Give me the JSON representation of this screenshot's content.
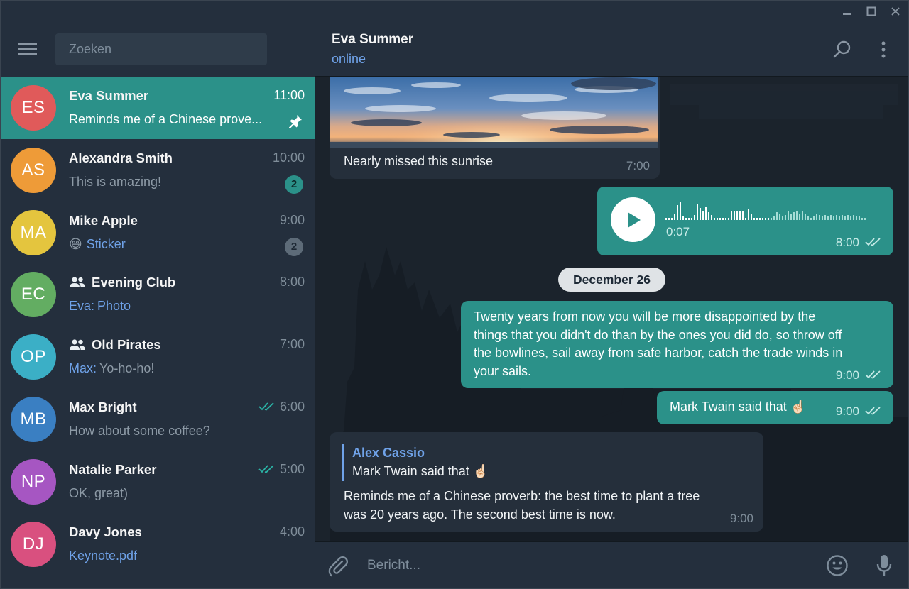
{
  "search": {
    "placeholder": "Zoeken"
  },
  "chats": [
    {
      "initials": "ES",
      "name": "Eva Summer",
      "time": "11:00",
      "preview": "Reminds me of a Chinese prove...",
      "avatar_color": "#e05a5a",
      "active": true,
      "pinned": true
    },
    {
      "initials": "AS",
      "name": "Alexandra Smith",
      "time": "10:00",
      "preview": "This is amazing!",
      "avatar_color": "#ee9b38",
      "badge": "2",
      "badge_style": "teal"
    },
    {
      "initials": "MA",
      "name": "Mike Apple",
      "time": "9:00",
      "preview": "Sticker",
      "preview_emoji": "😄",
      "avatar_color": "#e4c53e",
      "badge": "2",
      "badge_style": "grey"
    },
    {
      "initials": "EC",
      "name": "Evening Club",
      "time": "8:00",
      "preview_sender": "Eva:",
      "preview": "Photo",
      "avatar_color": "#63ad62",
      "group": true
    },
    {
      "initials": "OP",
      "name": "Old Pirates",
      "time": "7:00",
      "preview_sender": "Max:",
      "preview": "Yo-ho-ho!",
      "avatar_color": "#3bafc6",
      "group": true
    },
    {
      "initials": "MB",
      "name": "Max Bright",
      "time": "6:00",
      "preview": "How about some coffee?",
      "avatar_color": "#3a7fc2",
      "read": true
    },
    {
      "initials": "NP",
      "name": "Natalie Parker",
      "time": "5:00",
      "preview": "OK, great)",
      "avatar_color": "#a656c2",
      "read": true
    },
    {
      "initials": "DJ",
      "name": "Davy Jones",
      "time": "4:00",
      "preview": "Keynote.pdf",
      "preview_link": true,
      "avatar_color": "#d9507f"
    }
  ],
  "header": {
    "name": "Eva Summer",
    "status": "online"
  },
  "messages": {
    "photo": {
      "caption": "Nearly missed this sunrise",
      "time": "7:00"
    },
    "voice": {
      "duration": "0:07",
      "time": "8:00"
    },
    "date_separator": "December 26",
    "quote": {
      "lines": [
        "Twenty years from now you will be more disappointed by the",
        "things that you didn't do than by the ones you did do, so throw off",
        "the bowlines, sail away from safe harbor, catch the trade winds in",
        "your sails."
      ],
      "time": "9:00"
    },
    "twain": {
      "text": "Mark Twain said that",
      "emoji": "☝🏻",
      "time": "9:00"
    },
    "reply": {
      "reply_to_name": "Alex Cassio",
      "reply_to_text": "Mark Twain said that",
      "reply_to_emoji": "☝🏻",
      "lines": [
        "Reminds me of a Chinese proverb: the best time to plant a tree",
        "was 20 years ago. The second best time is now."
      ],
      "time": "9:00"
    }
  },
  "composer": {
    "placeholder": "Bericht..."
  },
  "colors": {
    "accent": "#2b9189",
    "link": "#6fa2e8",
    "sidebar_bg": "#242f3d",
    "chat_bg": "#1b232c"
  }
}
